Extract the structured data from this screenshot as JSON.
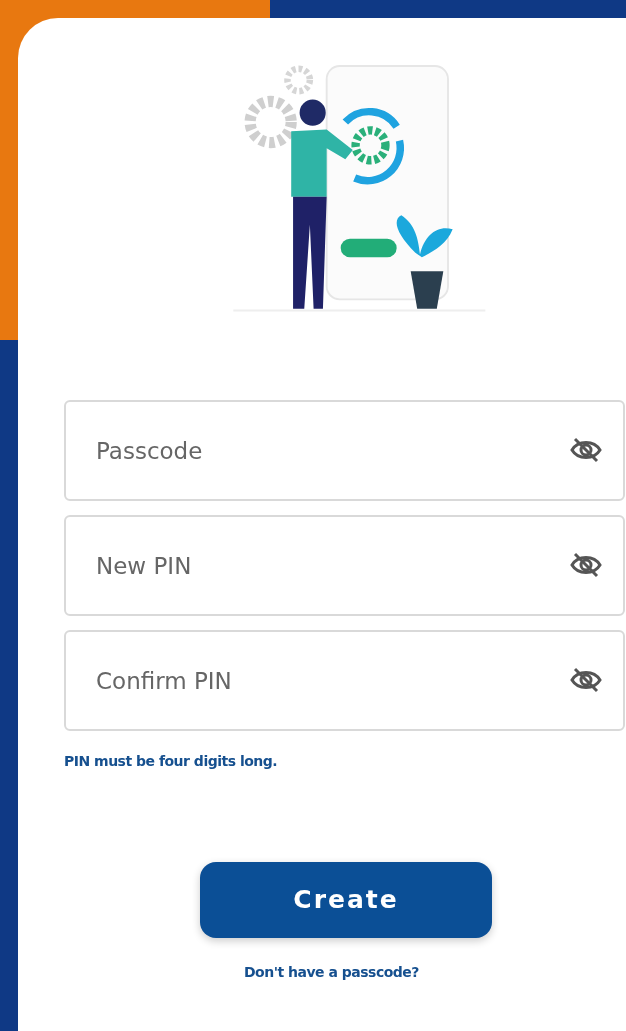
{
  "fields": [
    {
      "placeholder": "Passcode",
      "masked": true
    },
    {
      "placeholder": "New PIN",
      "masked": true
    },
    {
      "placeholder": "Confirm PIN",
      "masked": true
    }
  ],
  "hint": "PIN must be four digits long.",
  "submit": "Create",
  "link": "Don't have a passcode?"
}
